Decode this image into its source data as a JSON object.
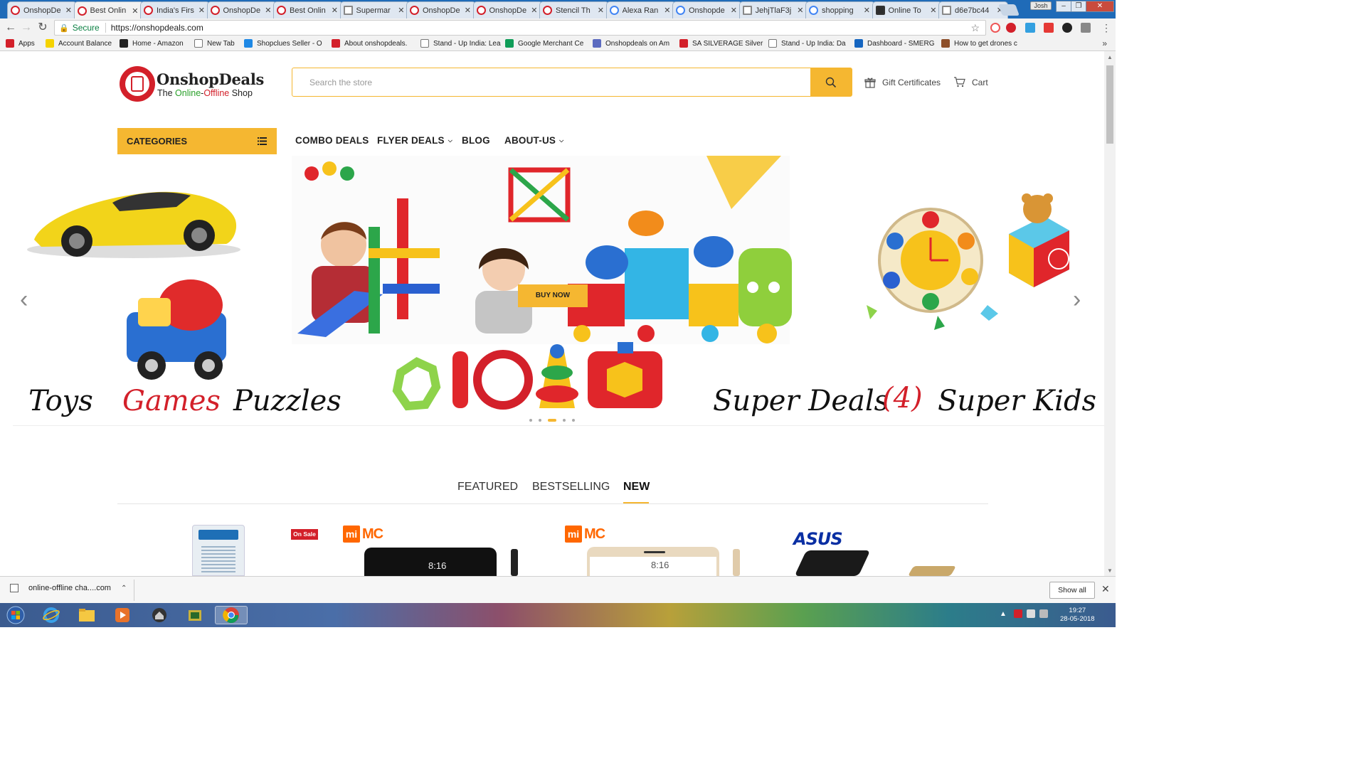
{
  "browser": {
    "tabs": [
      {
        "title": "OnshopDe",
        "icon": "onshop-favicon"
      },
      {
        "title": "Best Onlin",
        "icon": "onshop-favicon",
        "active": true
      },
      {
        "title": "India's Firs",
        "icon": "onshop-favicon"
      },
      {
        "title": "OnshopDe",
        "icon": "onshop-favicon"
      },
      {
        "title": "Best Onlin",
        "icon": "onshop-favicon"
      },
      {
        "title": "Supermar",
        "icon": "doc-favicon"
      },
      {
        "title": "OnshopDe",
        "icon": "onshop-favicon"
      },
      {
        "title": "OnshopDe",
        "icon": "onshop-favicon"
      },
      {
        "title": "Stencil Th",
        "icon": "onshop-favicon"
      },
      {
        "title": "Alexa Ran",
        "icon": "google-favicon"
      },
      {
        "title": "Onshopde",
        "icon": "google-favicon"
      },
      {
        "title": "JehjTlaF3j",
        "icon": "doc-favicon"
      },
      {
        "title": "shopping",
        "icon": "google-favicon"
      },
      {
        "title": "Online To",
        "icon": "site-favicon"
      },
      {
        "title": "d6e7bc44",
        "icon": "doc-favicon"
      }
    ],
    "profile": "Josh",
    "window_buttons": {
      "minimize": "–",
      "maximize": "❐",
      "close": "✕"
    },
    "address": {
      "secure_label": "Secure",
      "url": "https://onshopdeals.com"
    },
    "bookmarks": [
      {
        "label": "Apps",
        "icon": "apps-grid-icon",
        "color": "#d3202a"
      },
      {
        "label": "Account Balance",
        "icon": "flipkart-icon",
        "color": "#f5d300"
      },
      {
        "label": "Home - Amazon",
        "icon": "amazon-icon",
        "color": "#222222"
      },
      {
        "label": "New Tab",
        "icon": "page-icon",
        "color": "#ffffff"
      },
      {
        "label": "Shopclues Seller - O",
        "icon": "check-circle-icon",
        "color": "#1e88e5"
      },
      {
        "label": "About onshopdeals.",
        "icon": "onshop-icon",
        "color": "#d3202a"
      },
      {
        "label": "Stand - Up India: Lea",
        "icon": "page-icon",
        "color": "#ffffff"
      },
      {
        "label": "Google Merchant Ce",
        "icon": "sheet-icon",
        "color": "#0f9d58"
      },
      {
        "label": "Onshopdeals on Am",
        "icon": "circle-icon",
        "color": "#5c6bc0"
      },
      {
        "label": "SA SILVERAGE Silver",
        "icon": "onshop-icon",
        "color": "#d3202a"
      },
      {
        "label": "Stand - Up India: Da",
        "icon": "page-icon",
        "color": "#ffffff"
      },
      {
        "label": "Dashboard - SMERG",
        "icon": "chart-icon",
        "color": "#1565c0"
      },
      {
        "label": "How to get drones c",
        "icon": "drone-icon",
        "color": "#8d4f2a"
      }
    ],
    "more_bookmarks": "»"
  },
  "site": {
    "logo": {
      "name": "OnshopDeals",
      "tag_prefix": "The ",
      "tag_online": "Online",
      "tag_dash": "-",
      "tag_offline": "Offline",
      "tag_suffix": " Shop"
    },
    "search": {
      "placeholder": "Search the store"
    },
    "gift_label": "Gift Certificates",
    "cart_label": "Cart",
    "categories_label": "CATEGORIES",
    "nav": [
      {
        "label": "COMBO DEALS",
        "dropdown": false
      },
      {
        "label": "FLYER DEALS",
        "dropdown": true
      },
      {
        "label": "BLOG",
        "dropdown": false
      },
      {
        "label": "ABOUT-US",
        "dropdown": true
      }
    ],
    "hero": {
      "words": [
        "Toys",
        "Games",
        "Puzzles",
        "Super Deals",
        "(4)",
        "Super Kids"
      ],
      "buy_now": "BUY NOW",
      "slides": 5,
      "active_slide": 3,
      "prev": "‹",
      "next": "›"
    },
    "product_tabs": [
      {
        "label": "FEATURED",
        "active": false
      },
      {
        "label": "BESTSELLING",
        "active": false
      },
      {
        "label": "NEW",
        "active": true
      }
    ],
    "products": {
      "on_sale": "On Sale",
      "mi_logo": "mi",
      "mi_brand": "MC",
      "phone_time": "8:16",
      "asus": "ASUS"
    },
    "colors": {
      "accent": "#f5b731",
      "brand_red": "#d3202a",
      "mi_orange": "#ff6700"
    }
  },
  "downloads": {
    "file": "online-offline cha....com",
    "show_all": "Show all",
    "close": "✕"
  },
  "taskbar": {
    "time": "19:27",
    "date": "28-05-2018"
  }
}
